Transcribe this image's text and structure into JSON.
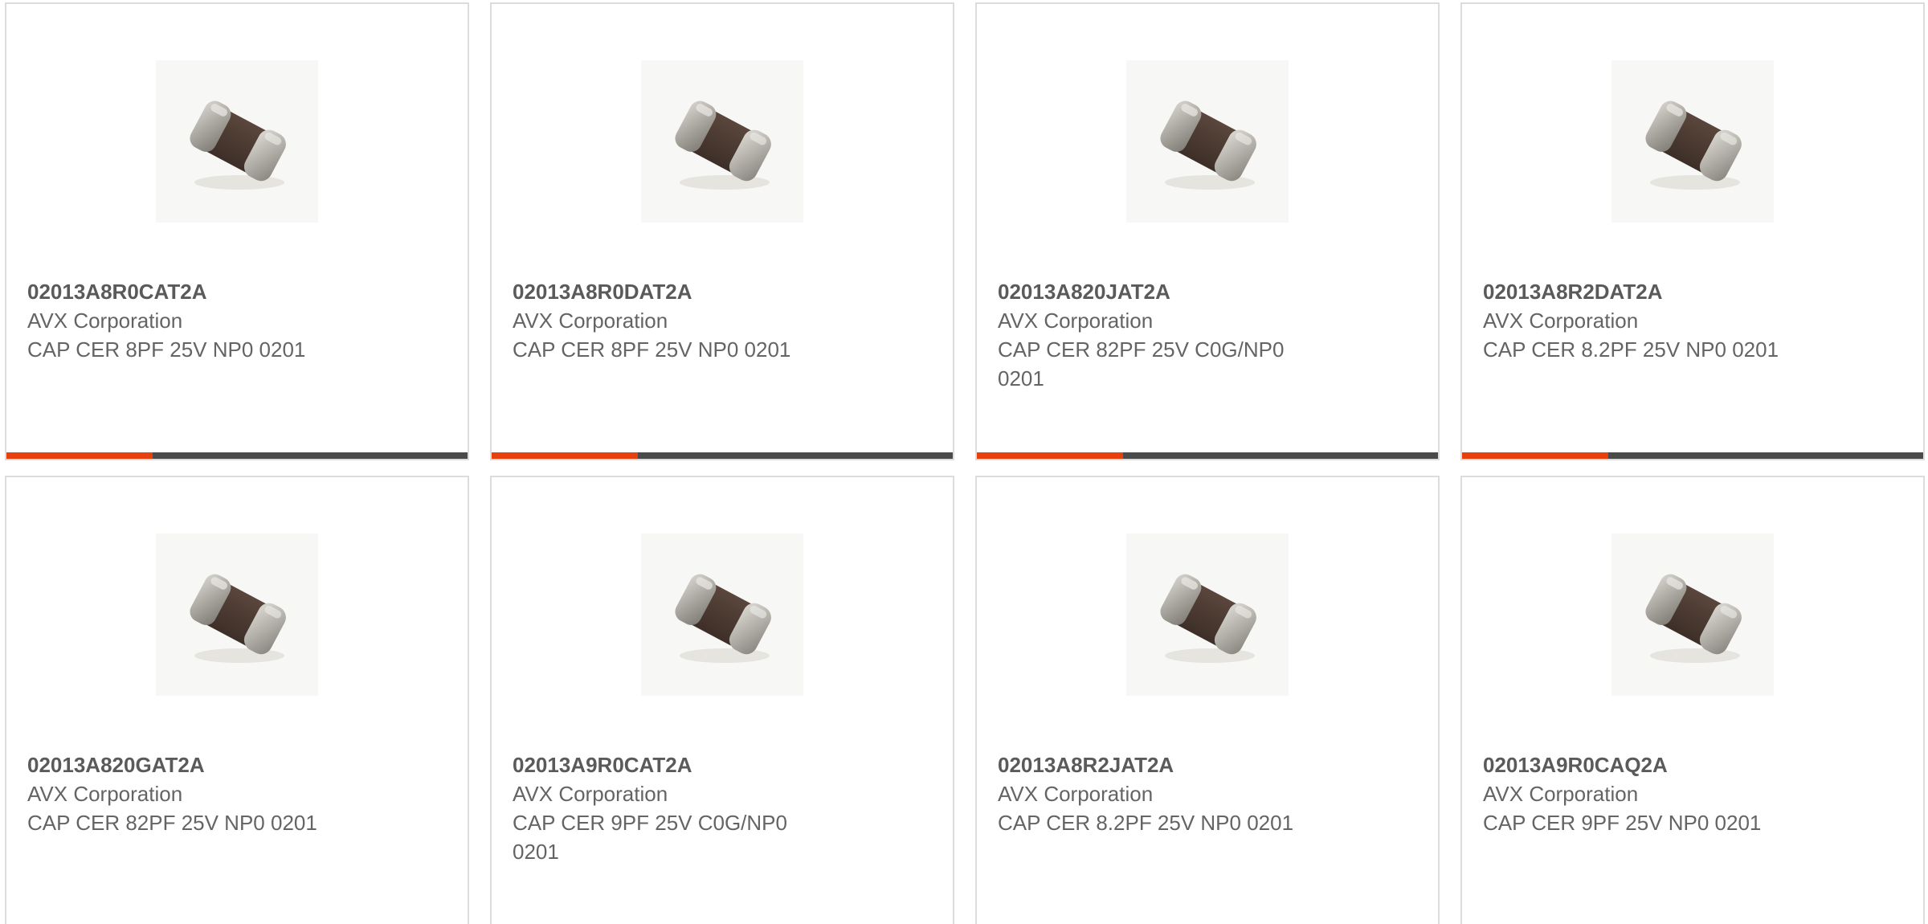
{
  "colors": {
    "accent": "#e8400c",
    "bar": "#4a4a4a",
    "border": "#dcdcdc",
    "text": "#5f5f5f"
  },
  "products": [
    {
      "part_number": "02013A8R0CAT2A",
      "manufacturer": "AVX Corporation",
      "description": "CAP CER 8PF 25V NP0 0201",
      "image_icon": "ceramic-chip-capacitor"
    },
    {
      "part_number": "02013A8R0DAT2A",
      "manufacturer": "AVX Corporation",
      "description": "CAP CER 8PF 25V NP0 0201",
      "image_icon": "ceramic-chip-capacitor"
    },
    {
      "part_number": "02013A820JAT2A",
      "manufacturer": "AVX Corporation",
      "description": "CAP CER 82PF 25V C0G/NP0 0201",
      "image_icon": "ceramic-chip-capacitor"
    },
    {
      "part_number": "02013A8R2DAT2A",
      "manufacturer": "AVX Corporation",
      "description": "CAP CER 8.2PF 25V NP0 0201",
      "image_icon": "ceramic-chip-capacitor"
    },
    {
      "part_number": "02013A820GAT2A",
      "manufacturer": "AVX Corporation",
      "description": "CAP CER 82PF 25V NP0 0201",
      "image_icon": "ceramic-chip-capacitor"
    },
    {
      "part_number": "02013A9R0CAT2A",
      "manufacturer": "AVX Corporation",
      "description": "CAP CER 9PF 25V C0G/NP0 0201",
      "image_icon": "ceramic-chip-capacitor"
    },
    {
      "part_number": "02013A8R2JAT2A",
      "manufacturer": "AVX Corporation",
      "description": "CAP CER 8.2PF 25V NP0 0201",
      "image_icon": "ceramic-chip-capacitor"
    },
    {
      "part_number": "02013A9R0CAQ2A",
      "manufacturer": "AVX Corporation",
      "description": "CAP CER 9PF 25V NP0 0201",
      "image_icon": "ceramic-chip-capacitor"
    }
  ]
}
